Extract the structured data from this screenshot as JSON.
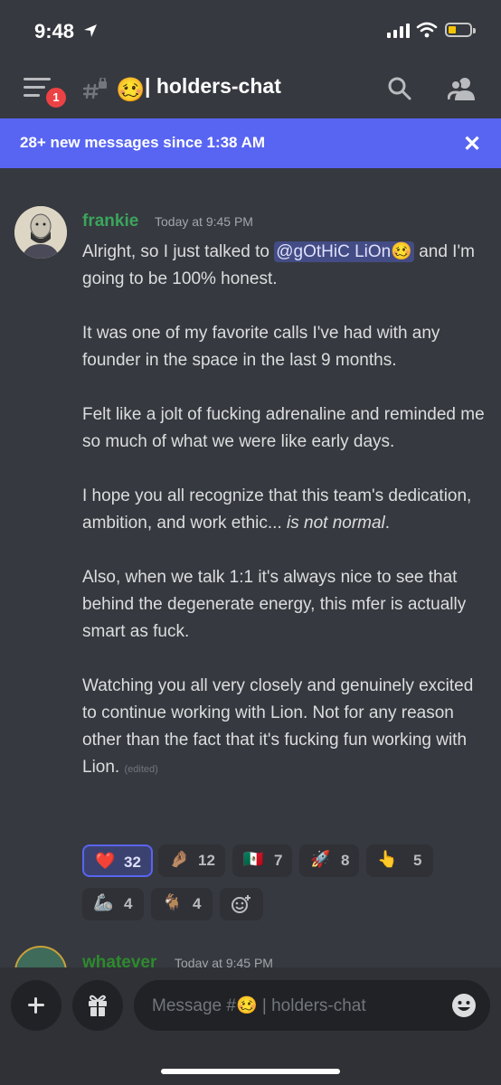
{
  "status_bar": {
    "time": "9:48",
    "icons": [
      "location-arrow-icon",
      "signal-icon",
      "wifi-icon",
      "battery-icon"
    ]
  },
  "header": {
    "menu_badge": "1",
    "channel_emoji": "🥴",
    "channel_name": "| holders-chat",
    "icons": [
      "hamburger-icon",
      "locked-channel-icon",
      "search-icon",
      "members-icon"
    ]
  },
  "banner": {
    "text": "28+ new messages since 1:38 AM",
    "close_glyph": "✕"
  },
  "message": {
    "author": "frankie",
    "timestamp": "Today at 9:45 PM",
    "p1_before": "Alright, so I just talked to ",
    "mention": "@gOtHiC LiOn🥴",
    "p1_after": " and I'm going to be 100% honest.",
    "p2": "It was one of my favorite calls I've had with any founder in the space in the last 9 months.",
    "p3": "Felt like a jolt of fucking adrenaline and reminded me so much of what we were like early days.",
    "p4_before": "I hope you all recognize that this team's dedication, ambition, and work ethic... ",
    "p4_italic": "is not normal",
    "p4_after": ".",
    "p5": "Also, when we talk 1:1 it's always nice to see that behind the degenerate energy, this mfer is actually smart as fuck.",
    "p6": "Watching you all very closely and genuinely excited to continue working with Lion. Not for any reason other than the fact that it's fucking fun working with Lion.",
    "edited": "(edited)"
  },
  "reactions": [
    {
      "emoji": "❤️",
      "count": "32",
      "active": true
    },
    {
      "emoji": "🤌🏽",
      "count": "12"
    },
    {
      "emoji": "🇲🇽",
      "count": "7"
    },
    {
      "emoji": "🚀",
      "count": "8"
    },
    {
      "emoji": "👆",
      "count": "5"
    },
    {
      "emoji": "🦾",
      "count": "4"
    },
    {
      "emoji": "🐐",
      "count": "4"
    },
    {
      "emoji": "add-reaction-icon",
      "count": ""
    }
  ],
  "next_message": {
    "author": "whatever",
    "timestamp": "Today at 9:45 PM"
  },
  "composer": {
    "placeholder": "Message #🥴 | holders-chat",
    "icons": [
      "plus-icon",
      "gift-icon",
      "emoji-icon"
    ]
  }
}
